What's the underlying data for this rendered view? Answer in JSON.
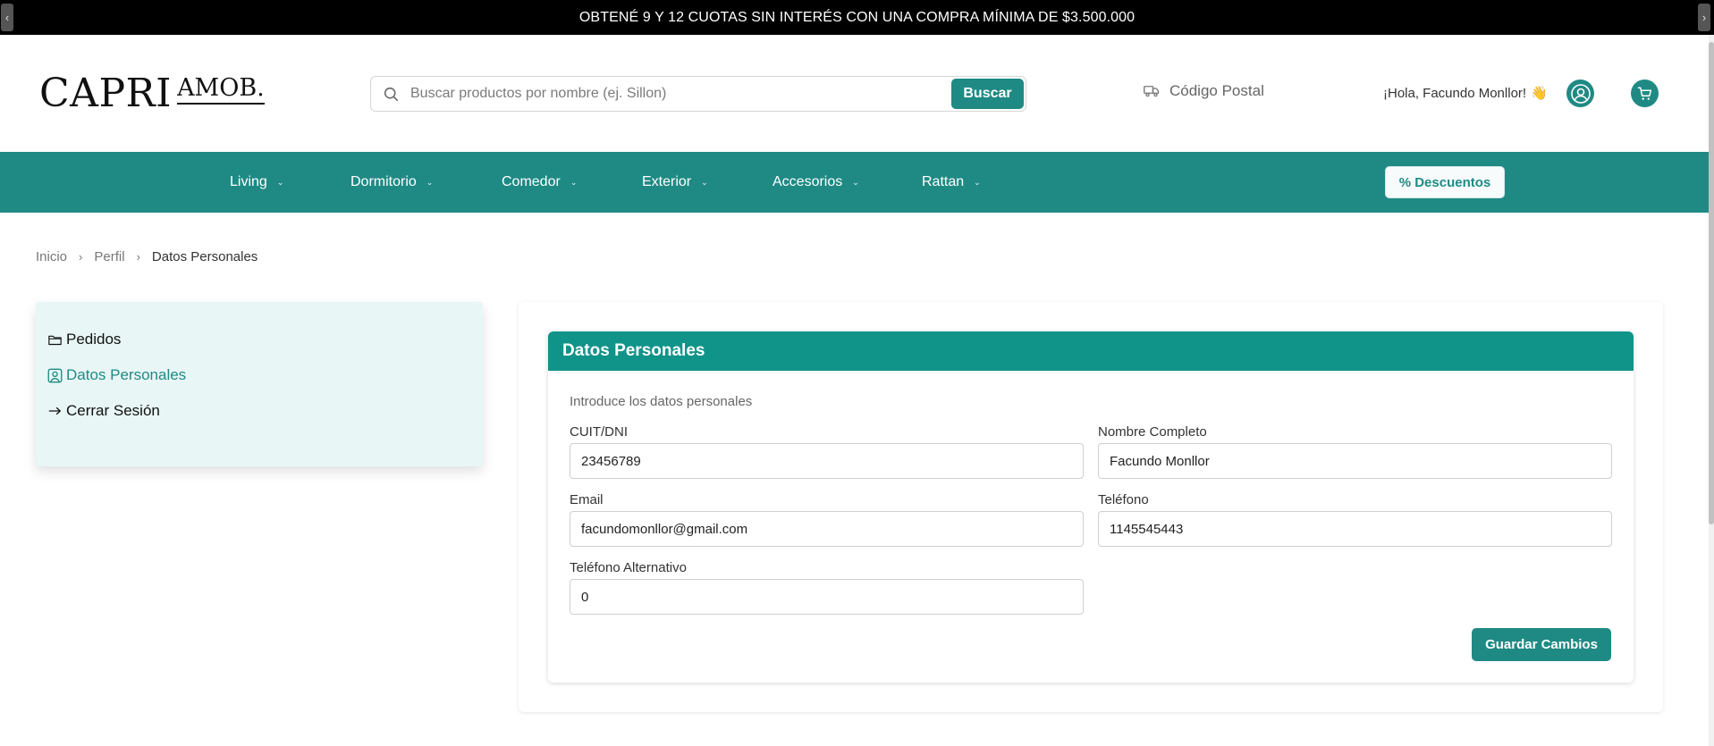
{
  "promo": {
    "text": "OBTENÉ 9 Y 12 CUOTAS SIN INTERÉS CON UNA COMPRA MÍNIMA DE $3.500.000",
    "prev_icon": "chevron-left-icon",
    "next_icon": "chevron-right-icon"
  },
  "header": {
    "logo_main": "CAPRI",
    "logo_sub": "AMOB.",
    "search_placeholder": "Buscar productos por nombre (ej. Sillon)",
    "search_button": "Buscar",
    "postal_label": "Código Postal",
    "greeting": "¡Hola, Facundo Monllor!",
    "greeting_emoji": "👋"
  },
  "nav": {
    "items": [
      {
        "label": "Living"
      },
      {
        "label": "Dormitorio"
      },
      {
        "label": "Comedor"
      },
      {
        "label": "Exterior"
      },
      {
        "label": "Accesorios"
      },
      {
        "label": "Rattan"
      }
    ],
    "discount_button": "% Descuentos"
  },
  "breadcrumb": {
    "items": [
      "Inicio",
      "Perfil",
      "Datos Personales"
    ]
  },
  "sidebar": {
    "items": [
      {
        "label": "Pedidos",
        "icon": "folder-icon"
      },
      {
        "label": "Datos Personales",
        "icon": "user-card-icon",
        "active": true
      },
      {
        "label": "Cerrar Sesión",
        "icon": "arrow-right-icon"
      }
    ]
  },
  "form": {
    "title": "Datos Personales",
    "subtitle": "Introduce los datos personales",
    "fields": {
      "cuit": {
        "label": "CUIT/DNI",
        "value": "23456789"
      },
      "nombre": {
        "label": "Nombre Completo",
        "value": "Facundo Monllor"
      },
      "email": {
        "label": "Email",
        "value": "facundomonllor@gmail.com"
      },
      "telefono": {
        "label": "Teléfono",
        "value": "1145545443"
      },
      "telefono_alt": {
        "label": "Teléfono Alternativo",
        "value": "0"
      }
    },
    "save_button": "Guardar Cambios"
  },
  "colors": {
    "brand": "#1f8a84",
    "card_header": "#10948a",
    "sidebar_bg": "#e8f6f5"
  }
}
